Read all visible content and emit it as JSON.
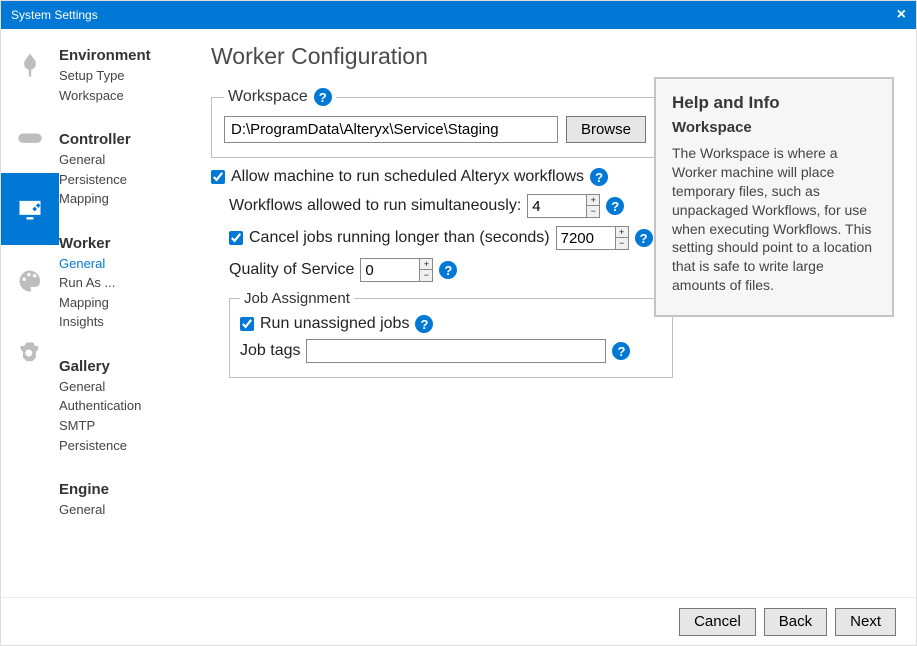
{
  "window": {
    "title": "System Settings"
  },
  "nav": {
    "groups": [
      {
        "title": "Environment",
        "items": [
          "Setup Type",
          "Workspace"
        ]
      },
      {
        "title": "Controller",
        "items": [
          "General",
          "Persistence",
          "Mapping"
        ]
      },
      {
        "title": "Worker",
        "items": [
          "General",
          "Run As ...",
          "Mapping",
          "Insights"
        ],
        "activeItem": 0
      },
      {
        "title": "Gallery",
        "items": [
          "General",
          "Authentication",
          "SMTP",
          "Persistence"
        ]
      },
      {
        "title": "Engine",
        "items": [
          "General"
        ]
      }
    ],
    "activeGroup": 2
  },
  "page": {
    "title": "Worker Configuration",
    "workspace": {
      "legend": "Workspace",
      "path": "D:\\ProgramData\\Alteryx\\Service\\Staging",
      "browse": "Browse"
    },
    "allow_scheduled": {
      "checked": true,
      "label": "Allow machine to run scheduled Alteryx workflows"
    },
    "simultaneous": {
      "label": "Workflows allowed to run simultaneously:",
      "value": "4"
    },
    "cancel_long": {
      "checked": true,
      "label": "Cancel jobs running longer than (seconds)",
      "value": "7200"
    },
    "qos": {
      "label": "Quality of Service",
      "value": "0"
    },
    "job_assignment": {
      "legend": "Job Assignment",
      "run_unassigned": {
        "checked": true,
        "label": "Run unassigned jobs"
      },
      "tags": {
        "label": "Job tags",
        "value": ""
      }
    }
  },
  "help": {
    "title": "Help and Info",
    "subtitle": "Workspace",
    "body": "The Workspace is where a Worker machine will place temporary files, such as unpackaged Workflows, for use when executing Workflows. This setting should point to a location that is safe to write large amounts of files."
  },
  "footer": {
    "cancel": "Cancel",
    "back": "Back",
    "next": "Next"
  }
}
